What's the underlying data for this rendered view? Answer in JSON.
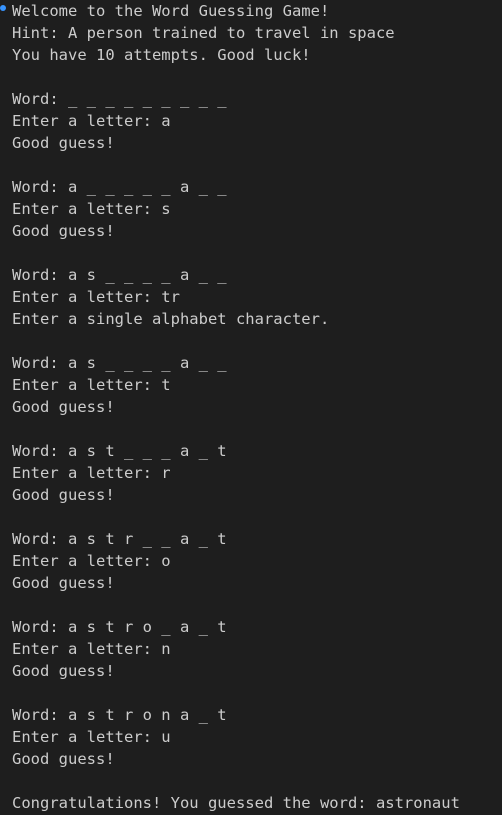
{
  "terminal": {
    "lines": [
      "Welcome to the Word Guessing Game!",
      "Hint: A person trained to travel in space",
      "You have 10 attempts. Good luck!",
      "",
      "Word: _ _ _ _ _ _ _ _ _",
      "Enter a letter: a",
      "Good guess!",
      "",
      "Word: a _ _ _ _ _ a _ _",
      "Enter a letter: s",
      "Good guess!",
      "",
      "Word: a s _ _ _ _ a _ _",
      "Enter a letter: tr",
      "Enter a single alphabet character.",
      "",
      "Word: a s _ _ _ _ a _ _",
      "Enter a letter: t",
      "Good guess!",
      "",
      "Word: a s t _ _ _ a _ t",
      "Enter a letter: r",
      "Good guess!",
      "",
      "Word: a s t r _ _ a _ t",
      "Enter a letter: o",
      "Good guess!",
      "",
      "Word: a s t r o _ a _ t",
      "Enter a letter: n",
      "Good guess!",
      "",
      "Word: a s t r o n a _ t",
      "Enter a letter: u",
      "Good guess!",
      "",
      "Congratulations! You guessed the word: astronaut"
    ]
  }
}
